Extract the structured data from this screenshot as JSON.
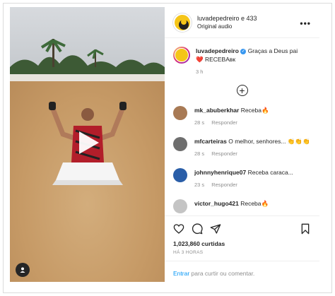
{
  "header": {
    "username": "luvadepedreiro e 433",
    "subtitle": "Original audio",
    "more_icon": "more-icon"
  },
  "caption": {
    "username": "luvadepedreiro",
    "text": "Graças a Deus pai",
    "text2": "❤️ RECEBAвк",
    "time": "3 h"
  },
  "comments": [
    {
      "username": "mk_abuberkhar",
      "text": "Receba🔥",
      "time": "28 s",
      "reply": "Responder",
      "avatar_color": "#a87a55"
    },
    {
      "username": "mfcarteiras",
      "text": "O melhor, senhores... 👏👏👏",
      "time": "28 s",
      "reply": "Responder",
      "avatar_color": "#6e6e6e"
    },
    {
      "username": "johnnyhenrique07",
      "text": "Receba caraca...",
      "time": "23 s",
      "reply": "Responder",
      "avatar_color": "#2a5ea8"
    },
    {
      "username": "victor_hugo421",
      "text": "Receba🔥",
      "time": "",
      "reply": "",
      "avatar_color": "#c4c4c4"
    }
  ],
  "actions": {
    "likes": "1,023,860 curtidas",
    "posted": "HÁ 3 HORAS"
  },
  "login": {
    "link": "Entrar",
    "text": "para curtir ou comentar."
  }
}
